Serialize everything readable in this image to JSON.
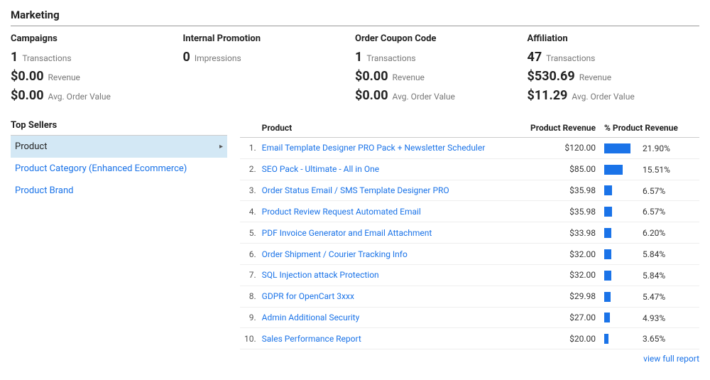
{
  "section_title": "Marketing",
  "cards": [
    {
      "title": "Campaigns",
      "lines": [
        {
          "value": "1",
          "label": "Transactions"
        },
        {
          "value": "$0.00",
          "label": "Revenue"
        },
        {
          "value": "$0.00",
          "label": "Avg. Order Value"
        }
      ]
    },
    {
      "title": "Internal Promotion",
      "lines": [
        {
          "value": "0",
          "label": "Impressions"
        }
      ]
    },
    {
      "title": "Order Coupon Code",
      "lines": [
        {
          "value": "1",
          "label": "Transactions"
        },
        {
          "value": "$0.00",
          "label": "Revenue"
        },
        {
          "value": "$0.00",
          "label": "Avg. Order Value"
        }
      ]
    },
    {
      "title": "Affiliation",
      "lines": [
        {
          "value": "47",
          "label": "Transactions"
        },
        {
          "value": "$530.69",
          "label": "Revenue"
        },
        {
          "value": "$11.29",
          "label": "Avg. Order Value"
        }
      ]
    }
  ],
  "sidebar": {
    "title": "Top Sellers",
    "items": [
      {
        "label": "Product",
        "active": true
      },
      {
        "label": "Product Category (Enhanced Ecommerce)",
        "active": false
      },
      {
        "label": "Product Brand",
        "active": false
      }
    ]
  },
  "table": {
    "headers": {
      "product": "Product",
      "revenue": "Product Revenue",
      "pct": "% Product Revenue"
    },
    "rows": [
      {
        "n": "1.",
        "name": "Email Template Designer PRO Pack + Newsletter Scheduler",
        "revenue": "$120.00",
        "pct_text": "21.90%",
        "pct_width": 21.9
      },
      {
        "n": "2.",
        "name": "SEO Pack - Ultimate - All in One",
        "revenue": "$85.00",
        "pct_text": "15.51%",
        "pct_width": 15.51
      },
      {
        "n": "3.",
        "name": "Order Status Email / SMS Template Designer PRO",
        "revenue": "$35.98",
        "pct_text": "6.57%",
        "pct_width": 6.57
      },
      {
        "n": "4.",
        "name": "Product Review Request Automated Email",
        "revenue": "$35.98",
        "pct_text": "6.57%",
        "pct_width": 6.57
      },
      {
        "n": "5.",
        "name": "PDF Invoice Generator and Email Attachment",
        "revenue": "$33.98",
        "pct_text": "6.20%",
        "pct_width": 6.2
      },
      {
        "n": "6.",
        "name": "Order Shipment / Courier Tracking Info",
        "revenue": "$32.00",
        "pct_text": "5.84%",
        "pct_width": 5.84
      },
      {
        "n": "7.",
        "name": "SQL Injection attack Protection",
        "revenue": "$32.00",
        "pct_text": "5.84%",
        "pct_width": 5.84
      },
      {
        "n": "8.",
        "name": "GDPR for OpenCart 3xxx",
        "revenue": "$29.98",
        "pct_text": "5.47%",
        "pct_width": 5.47
      },
      {
        "n": "9.",
        "name": "Admin Additional Security",
        "revenue": "$27.00",
        "pct_text": "4.93%",
        "pct_width": 4.93
      },
      {
        "n": "10.",
        "name": "Sales Performance Report",
        "revenue": "$20.00",
        "pct_text": "3.65%",
        "pct_width": 3.65
      }
    ]
  },
  "view_full": "view full report",
  "chart_data": {
    "type": "bar",
    "title": "% Product Revenue",
    "categories": [
      "Email Template Designer PRO Pack + Newsletter Scheduler",
      "SEO Pack - Ultimate - All in One",
      "Order Status Email / SMS Template Designer PRO",
      "Product Review Request Automated Email",
      "PDF Invoice Generator and Email Attachment",
      "Order Shipment / Courier Tracking Info",
      "SQL Injection attack Protection",
      "GDPR for OpenCart 3xxx",
      "Admin Additional Security",
      "Sales Performance Report"
    ],
    "values": [
      21.9,
      15.51,
      6.57,
      6.57,
      6.2,
      5.84,
      5.84,
      5.47,
      4.93,
      3.65
    ],
    "xlabel": "",
    "ylabel": "% Product Revenue",
    "ylim": [
      0,
      100
    ]
  }
}
